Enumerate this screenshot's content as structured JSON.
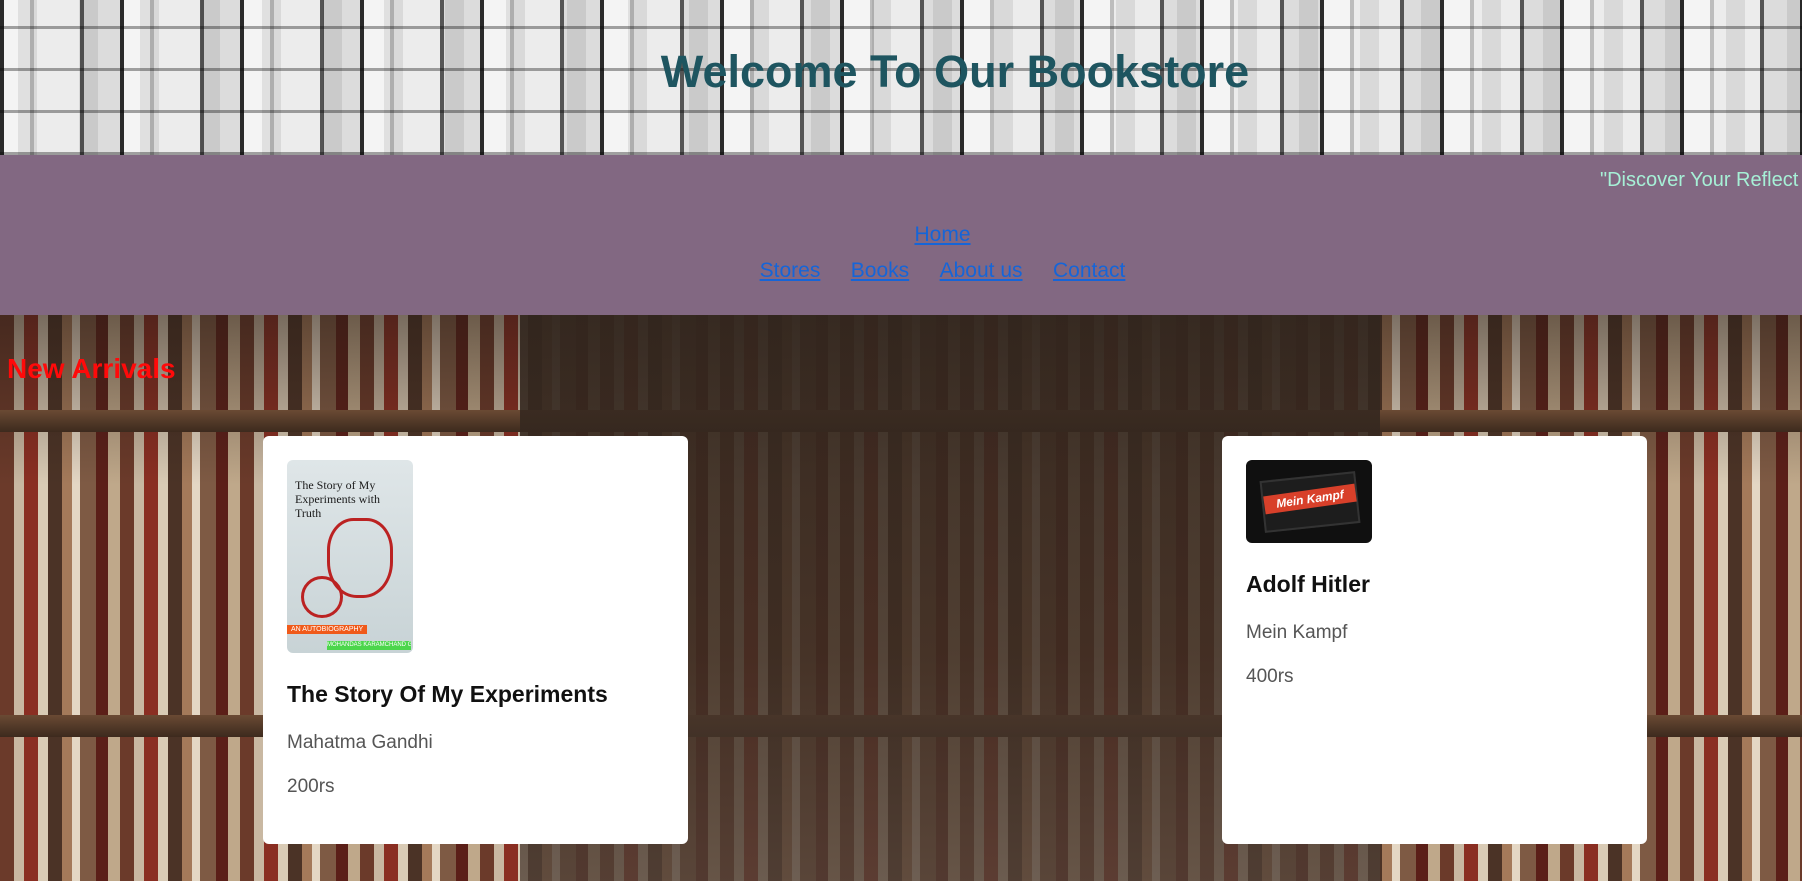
{
  "header": {
    "title": "Welcome To Our Bookstore"
  },
  "marquee": {
    "text": "\"Discover Your Reflect"
  },
  "nav": {
    "home": "Home",
    "items": [
      "Stores",
      "Books",
      "About us",
      "Contact"
    ]
  },
  "section": {
    "title": "New Arrivals"
  },
  "books": [
    {
      "title": "The Story Of My Experiments",
      "author": "Mahatma Gandhi",
      "price": "200rs",
      "cover_text": "The Story of My Experiments with Truth",
      "cover_tag": "AN AUTOBIOGRAPHY",
      "cover_author": "MOHANDAS KARAMCHAND GANDHI"
    },
    {
      "title": "Adolf Hitler",
      "author": "Mein Kampf",
      "price": "400rs",
      "cover_text": "Mein Kampf"
    }
  ],
  "colors": {
    "nav_band": "#826882",
    "title": "#1e5560",
    "section_title": "#ff0a0a",
    "link": "#1565d8",
    "marquee": "#a6f0d6"
  }
}
